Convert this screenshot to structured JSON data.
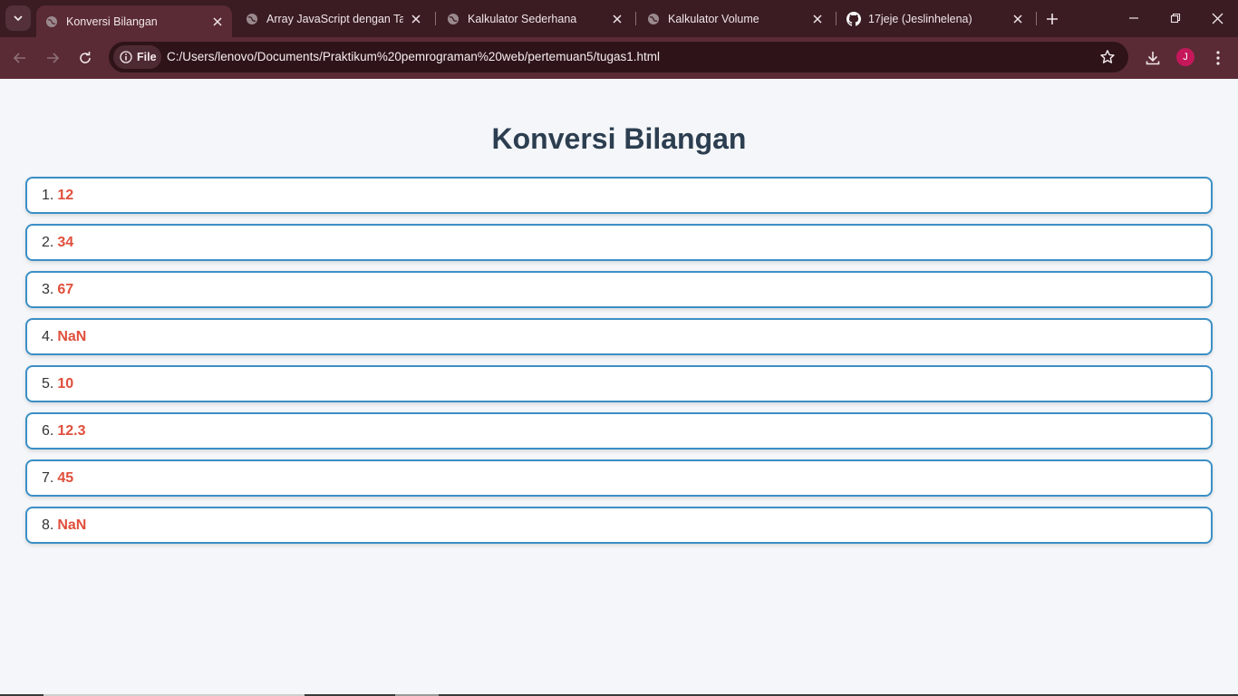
{
  "browser": {
    "tabs": [
      {
        "title": "Konversi Bilangan",
        "active": true,
        "icon": "globe-icon"
      },
      {
        "title": "Array JavaScript dengan Tabel",
        "active": false,
        "icon": "globe-icon"
      },
      {
        "title": "Kalkulator Sederhana",
        "active": false,
        "icon": "globe-icon"
      },
      {
        "title": "Kalkulator Volume",
        "active": false,
        "icon": "globe-icon"
      },
      {
        "title": "17jeje (Jeslinhelena)",
        "active": false,
        "icon": "github-icon"
      }
    ],
    "site_chip": "File",
    "url": "C:/Users/lenovo/Documents/Praktikum%20pemrograman%20web/pertemuan5/tugas1.html",
    "profile_initial": "J",
    "colors": {
      "tabstrip": "#3a1c22",
      "toolbar": "#5a2b35",
      "profile": "#c4185b"
    }
  },
  "page": {
    "title": "Konversi Bilangan",
    "items": [
      {
        "index": "1.",
        "value": "12"
      },
      {
        "index": "2.",
        "value": "34"
      },
      {
        "index": "3.",
        "value": "67"
      },
      {
        "index": "4.",
        "value": "NaN"
      },
      {
        "index": "5.",
        "value": "10"
      },
      {
        "index": "6.",
        "value": "12.3"
      },
      {
        "index": "7.",
        "value": "45"
      },
      {
        "index": "8.",
        "value": "NaN"
      }
    ],
    "colors": {
      "title": "#2c3e50",
      "border": "#3b8fc5",
      "value": "#e04f3c",
      "background": "#f4f6f9"
    }
  }
}
